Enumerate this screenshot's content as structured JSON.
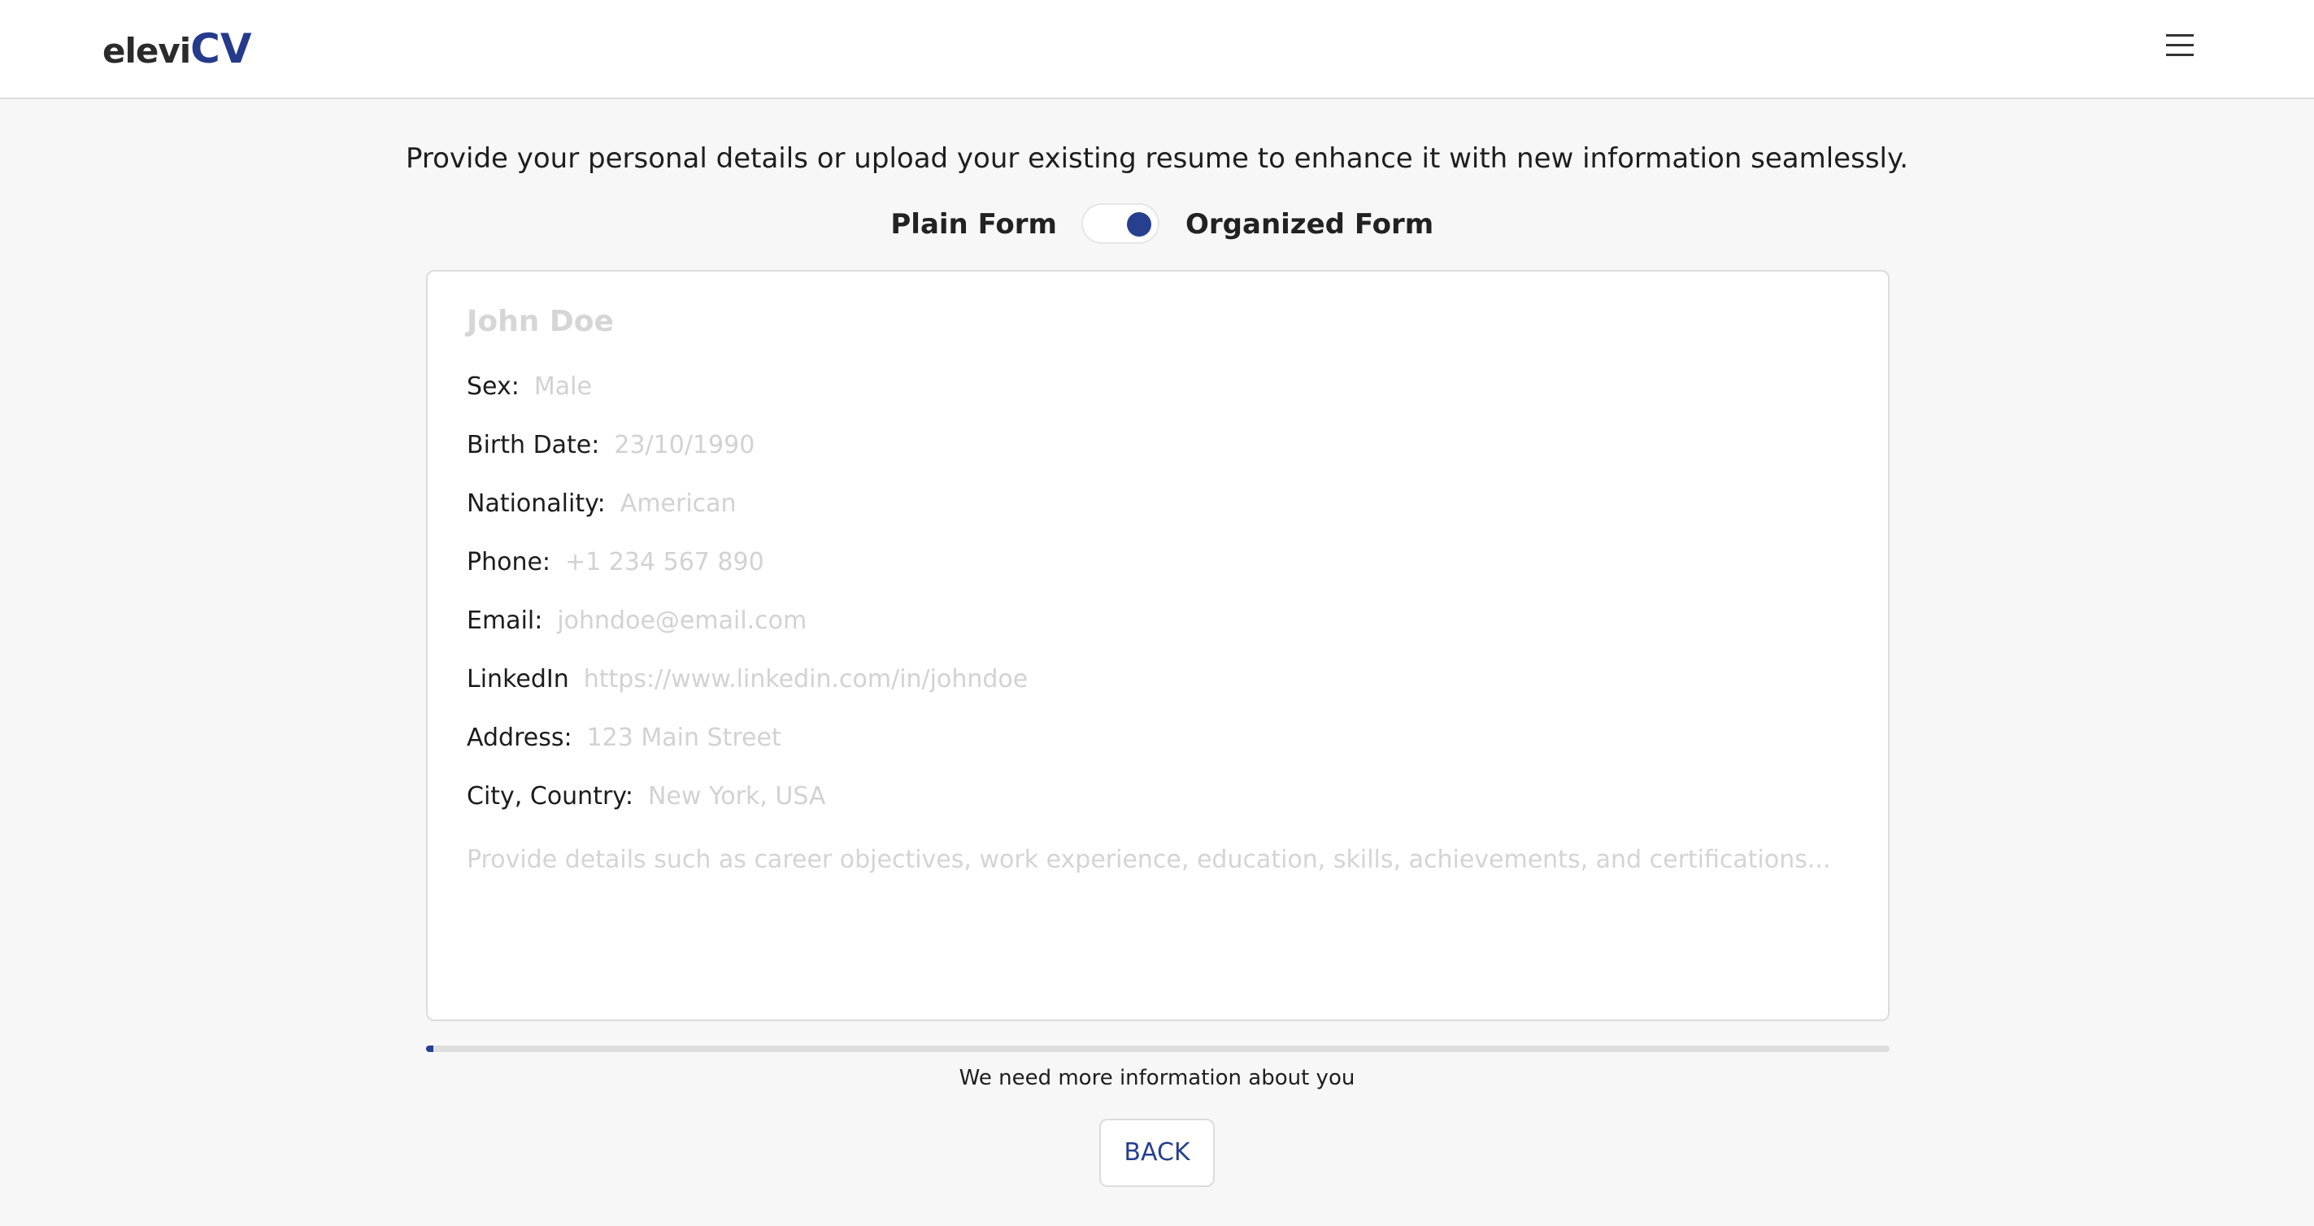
{
  "header": {
    "logo_part1": "elevi",
    "logo_part2": "CV",
    "menu_icon": "hamburger-menu-icon"
  },
  "intro_text": "Provide your personal details or upload your existing resume to enhance it with new information seamlessly.",
  "form_toggle": {
    "left_label": "Plain Form",
    "right_label": "Organized Form",
    "selected": "Organized Form",
    "accent_color": "#273f8f"
  },
  "form": {
    "name_placeholder": "John Doe",
    "fields": [
      {
        "label": "Sex:",
        "placeholder": "Male"
      },
      {
        "label": "Birth Date:",
        "placeholder": "23/10/1990"
      },
      {
        "label": "Nationality:",
        "placeholder": "American"
      },
      {
        "label": "Phone:",
        "placeholder": "+1 234 567 890"
      },
      {
        "label": "Email:",
        "placeholder": "johndoe@email.com"
      },
      {
        "label": "LinkedIn",
        "placeholder": "https://www.linkedin.com/in/johndoe"
      },
      {
        "label": "Address:",
        "placeholder": "123 Main Street"
      },
      {
        "label": "City, Country:",
        "placeholder": "New York, USA"
      }
    ],
    "details_placeholder": "Provide details such as career objectives, work experience, education, skills, achievements, and certifications..."
  },
  "progress": {
    "percent": 0.5,
    "status_text": "We need more information about you"
  },
  "back_button": "BACK"
}
